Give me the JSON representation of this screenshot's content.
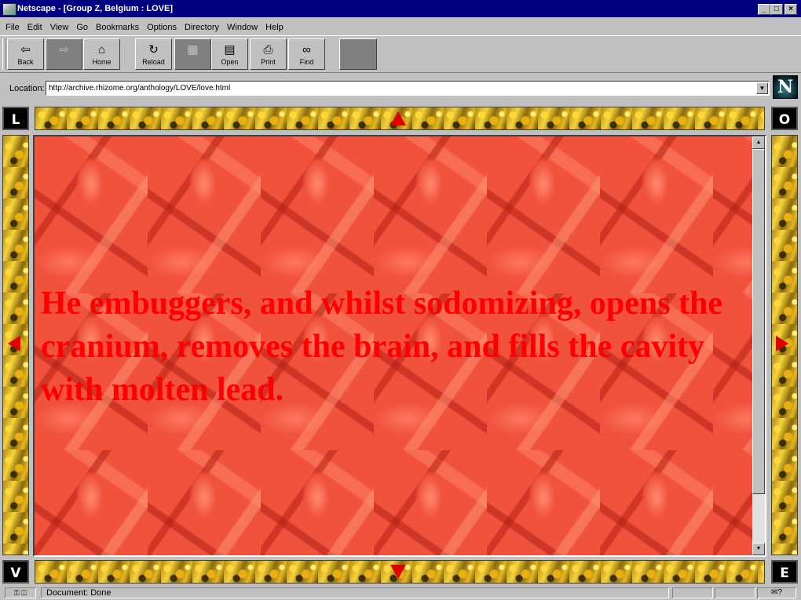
{
  "window": {
    "title": "Netscape - [Group Z, Belgium : LOVE]",
    "minimize": "_",
    "maximize": "□",
    "close": "×"
  },
  "menu": [
    {
      "label": "File"
    },
    {
      "label": "Edit"
    },
    {
      "label": "View"
    },
    {
      "label": "Go"
    },
    {
      "label": "Bookmarks"
    },
    {
      "label": "Options"
    },
    {
      "label": "Directory"
    },
    {
      "label": "Window"
    },
    {
      "label": "Help"
    }
  ],
  "toolbar": {
    "back": "Back",
    "home": "Home",
    "reload": "Reload",
    "open": "Open",
    "print": "Print",
    "find": "Find"
  },
  "location": {
    "label": "Location:",
    "url": "http://archive.rhizome.org/anthology/LOVE/love.html"
  },
  "frame": {
    "corner_top_left": "L",
    "corner_top_right": "O",
    "corner_bottom_left": "V",
    "corner_bottom_right": "E"
  },
  "content": {
    "text": "He embuggers, and whilst sodomizing, opens the cranium, removes the brain, and fills the cavity with molten lead."
  },
  "status": {
    "text": "Document: Done"
  },
  "colors": {
    "titlebar": "#000080",
    "chrome": "#c0c0c0",
    "content_text": "#ff0000",
    "arrows": "#e00000"
  }
}
